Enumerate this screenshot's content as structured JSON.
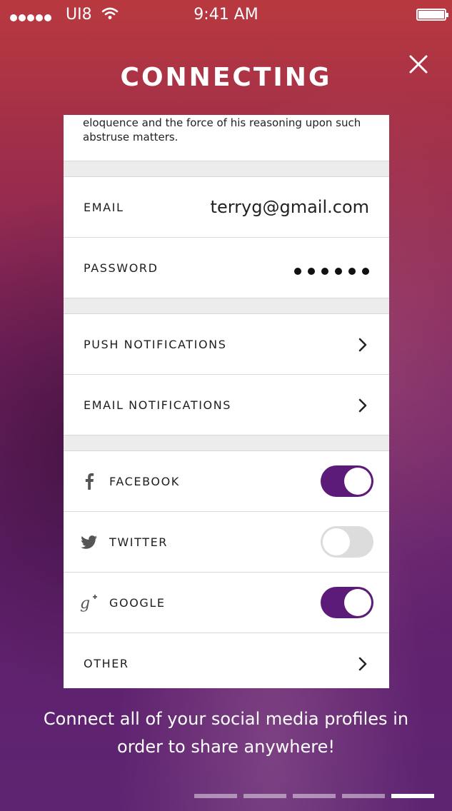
{
  "status_bar": {
    "carrier": "UI8",
    "time": "9:41 AM"
  },
  "header": {
    "title": "CONNECTING"
  },
  "intro": {
    "text": "eloquence and the force of his reasoning upon such abstruse matters."
  },
  "account": {
    "email_label": "EMAIL",
    "email_value": "terryg@gmail.com",
    "password_label": "PASSWORD"
  },
  "notifications": {
    "push_label": "PUSH NOTIFICATIONS",
    "email_label": "EMAIL NOTIFICATIONS"
  },
  "social": {
    "facebook": {
      "label": "FACEBOOK",
      "icon": "facebook-icon",
      "enabled": true
    },
    "twitter": {
      "label": "TWITTER",
      "icon": "twitter-icon",
      "enabled": false
    },
    "google": {
      "label": "GOOGLE",
      "icon": "google-plus-icon",
      "enabled": true
    },
    "other": {
      "label": "OTHER"
    }
  },
  "footer": {
    "message": "Connect all of your social media profiles in order to share anywhere!"
  },
  "pager": {
    "pages": 5,
    "active": 5
  },
  "colors": {
    "accent": "#5c1b78",
    "toggle_off": "#dcdcdc",
    "background_top": "#b9393f",
    "background_bottom": "#5d2471"
  }
}
